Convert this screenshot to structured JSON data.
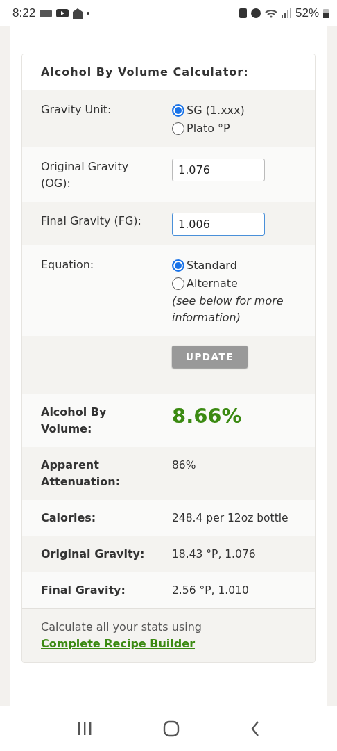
{
  "status_bar": {
    "time": "8:22",
    "battery": "52%"
  },
  "calculator": {
    "title": "Alcohol By Volume Calculator:",
    "inputs": [
      {
        "kind": "radio",
        "label": "Gravity Unit:",
        "options": [
          {
            "label": "SG (1.xxx)",
            "selected": true
          },
          {
            "label": "Plato °P",
            "selected": false
          }
        ]
      },
      {
        "kind": "field",
        "label": "Original Gravity (OG):",
        "value": "1.076",
        "focused": false
      },
      {
        "kind": "field",
        "label": "Final Gravity (FG):",
        "value": "1.006",
        "focused": true
      },
      {
        "kind": "radio",
        "label": "Equation:",
        "options": [
          {
            "label": "Standard",
            "selected": true
          },
          {
            "label": "Alternate",
            "selected": false
          }
        ],
        "note": "(see below for more information)"
      }
    ],
    "button": "UPDATE",
    "results": [
      {
        "label": "Alcohol By Volume:",
        "value": "8.66%",
        "highlight": true
      },
      {
        "label": "Apparent Attenuation:",
        "value": "86%",
        "highlight": false
      },
      {
        "label": "Calories:",
        "value": "248.4 per 12oz bottle",
        "highlight": false
      },
      {
        "label": "Original Gravity:",
        "value": "18.43 °P, 1.076",
        "highlight": false
      },
      {
        "label": "Final Gravity:",
        "value": "2.56 °P, 1.010",
        "highlight": false
      }
    ],
    "footer": {
      "text": "Calculate all your stats using",
      "link": "Complete Recipe Builder"
    }
  }
}
